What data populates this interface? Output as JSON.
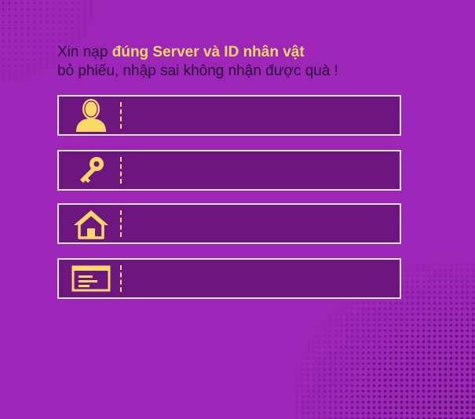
{
  "notice": {
    "prefix": "Xin nạp ",
    "highlight": "đúng Server và ID nhân vật",
    "line2": "bỏ phiếu, nhập sai không nhận được quà !"
  },
  "fields": [
    {
      "icon": "user-icon",
      "value": "",
      "placeholder": ""
    },
    {
      "icon": "key-icon",
      "value": "",
      "placeholder": ""
    },
    {
      "icon": "home-icon",
      "value": "",
      "placeholder": ""
    },
    {
      "icon": "id-card-icon",
      "value": "",
      "placeholder": ""
    }
  ],
  "colors": {
    "background": "#9d25b7",
    "field_background": "#6e1680",
    "field_border": "#f3e6f8",
    "accent": "#ffd966",
    "text": "#2a0a3a"
  }
}
